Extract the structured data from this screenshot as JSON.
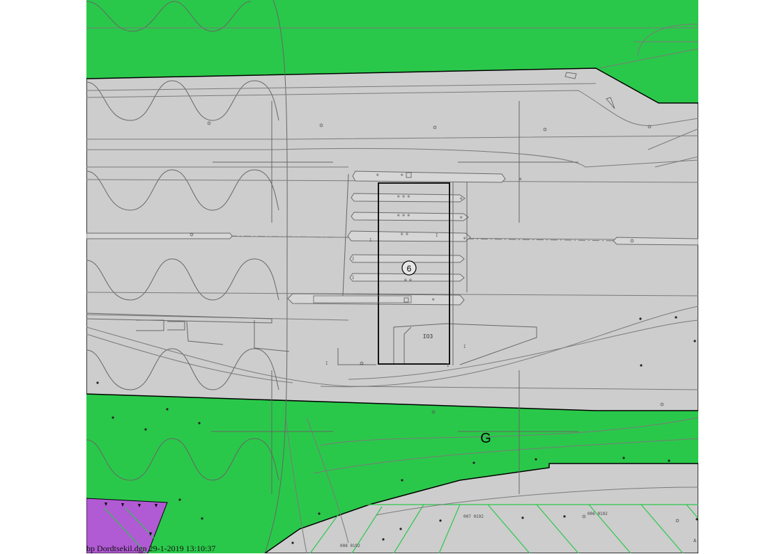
{
  "map": {
    "zone_label": "G",
    "plot_label": "6",
    "building_label": "IO3",
    "parcel_labels": [
      "007 0192",
      "006 0192",
      "008 0192"
    ],
    "edge_letter": "A",
    "colors": {
      "green_zone": "#2ac84a",
      "road_zone": "#cdcdcd",
      "purple_zone": "#b05ad4",
      "hatch_lines": "#2ac84a",
      "outline": "#000000"
    }
  },
  "footer": {
    "text": "bp Dordtsekil.dgn 29-1-2019 13:10:37"
  }
}
